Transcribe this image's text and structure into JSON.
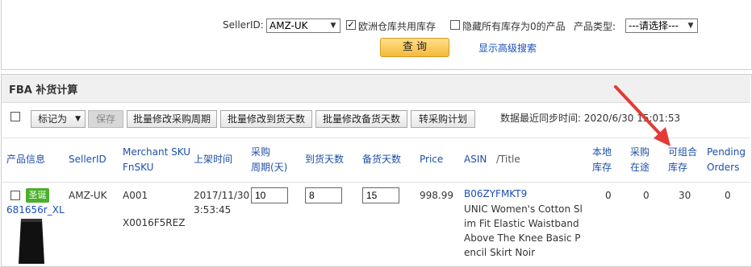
{
  "filters": {
    "seller_label": "SellerID:",
    "seller_value": "AMZ-UK",
    "eu_share_checked": true,
    "eu_share_label": "欧洲仓库共用库存",
    "hide_zero_checked": false,
    "hide_zero_label": "隐藏所有库存为0的产品",
    "type_label": "产品类型:",
    "type_value": "---请选择---",
    "query_button": "查 询",
    "advanced_link": "显示高级搜索"
  },
  "fba": {
    "title": "FBA 补货计算",
    "mark_as": "标记为",
    "save": "保存",
    "batch_purchase_cycle": "批量修改采购周期",
    "batch_arrival_days": "批量修改到货天数",
    "batch_stock_days": "批量修改备货天数",
    "to_purchase_plan": "转采购计划",
    "sync_label": "数据最近同步时间:",
    "sync_time": "2020/6/30 15:01:53"
  },
  "table": {
    "headers": {
      "product_info": "产品信息",
      "seller_id": "SellerID",
      "merchant_sku_1": "Merchant SKU",
      "merchant_sku_2": "FnSKU",
      "list_time": "上架时间",
      "purchase_cycle_1": "采购",
      "purchase_cycle_2": "周期(天)",
      "arrival_days": "到货天数",
      "stock_days": "备货天数",
      "price": "Price",
      "asin": "ASIN",
      "title": "/Title",
      "local_stock_1": "本地",
      "local_stock_2": "库存",
      "in_transit_1": "采购",
      "in_transit_2": "在途",
      "combinable_1": "可组合",
      "combinable_2": "库存",
      "pending_1": "Pending",
      "pending_2": "Orders"
    },
    "rows": [
      {
        "badge": "圣诞",
        "sku_link": "681656r_XL",
        "seller_id": "AMZ-UK",
        "merchant_sku": "A001",
        "fnsku": "X0016F5REZ",
        "list_time_1": "2017/11/30",
        "list_time_2": "3:53:45",
        "purchase_cycle": "10",
        "arrival_days": "8",
        "stock_days": "15",
        "price": "998.99",
        "asin": "B06ZYFMKT9",
        "title": "UNIC Women's Cotton Slim Fit Elastic Waistband Above The Knee Basic Pencil Skirt Noir",
        "local_stock": "0",
        "in_transit": "0",
        "combinable": "30",
        "pending": "0"
      }
    ]
  }
}
